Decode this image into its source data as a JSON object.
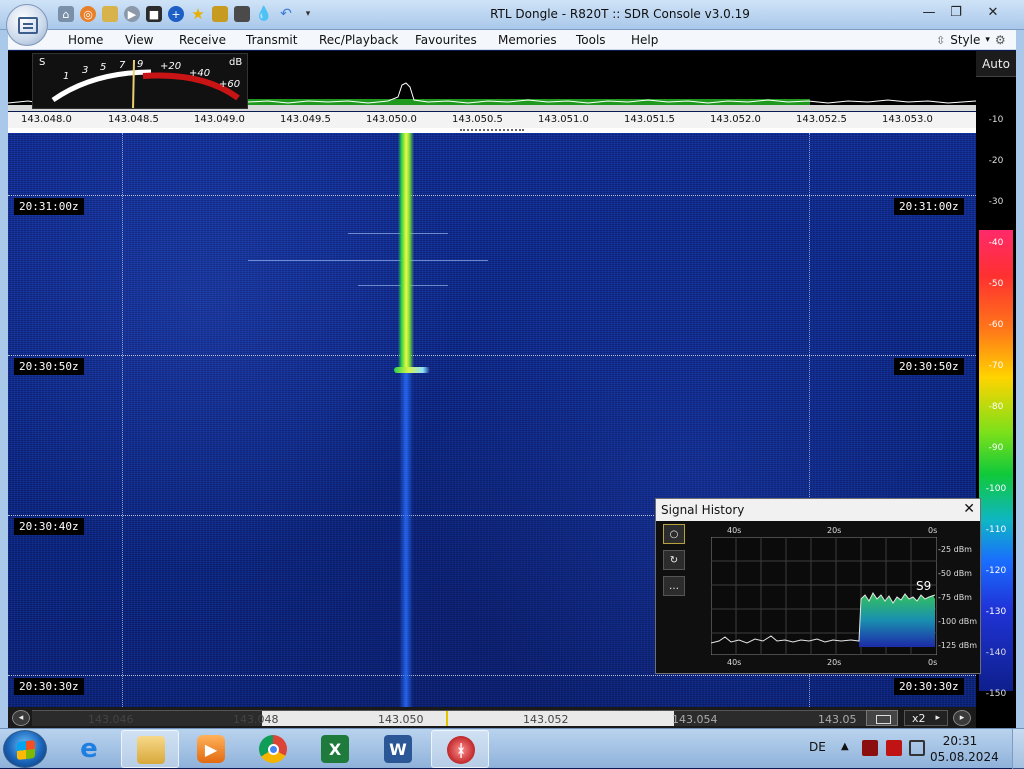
{
  "window": {
    "title": "RTL Dongle - R820T :: SDR Console v3.0.19",
    "minimize": "—",
    "maximize": "❐",
    "close": "✕"
  },
  "menu": {
    "items": [
      "Home",
      "View",
      "Receive",
      "Transmit",
      "Rec/Playback",
      "Favourites",
      "Memories",
      "Tools",
      "Help"
    ],
    "style_label": "Style"
  },
  "smeter": {
    "s_label": "S",
    "s_scale": [
      "1",
      "3",
      "5",
      "7",
      "9"
    ],
    "db_label": "dB",
    "db_scale": [
      "+20",
      "+40",
      "+60"
    ]
  },
  "frequency_axis": [
    "143.048.0",
    "143.048.5",
    "143.049.0",
    "143.049.5",
    "143.050.0",
    "143.050.5",
    "143.051.0",
    "143.051.5",
    "143.052.0",
    "143.052.5",
    "143.053.0"
  ],
  "waterfall": {
    "time_labels": [
      "20:31:00z",
      "20:30:50z",
      "20:30:40z",
      "20:30:30z"
    ]
  },
  "level_scale": {
    "auto_label": "Auto",
    "db_values": [
      "-10",
      "-20",
      "-30",
      "-40",
      "-50",
      "-60",
      "-70",
      "-80",
      "-90",
      "-100",
      "-110",
      "-120",
      "-130",
      "-140",
      "-150"
    ]
  },
  "bottom_bar": {
    "freq_labels": [
      "143.046",
      "143.048",
      "143.050",
      "143.052",
      "143.054",
      "143.05"
    ],
    "zoom_label": "x2",
    "zoom_arrow": "▸"
  },
  "signal_history": {
    "title": "Signal History",
    "close": "✕",
    "top_ticks": [
      "40s",
      "20s",
      "0s"
    ],
    "bottom_ticks": [
      "40s",
      "20s",
      "0s"
    ],
    "dbm_ticks": [
      "-25 dBm",
      "-50 dBm",
      "-75 dBm",
      "-100 dBm",
      "-125 dBm"
    ],
    "s_reading": "S9",
    "buttons": [
      "○",
      "↻",
      "…"
    ]
  },
  "taskbar": {
    "apps": [
      "internet-explorer",
      "file-explorer",
      "media-player",
      "chrome",
      "excel",
      "word",
      "sdr-console"
    ],
    "language": "DE",
    "tray_arrow": "▲",
    "time": "20:31",
    "date": "05.08.2024"
  },
  "colors": {
    "waterfall_bg": "#0d2a8c",
    "signal": "#d6f548",
    "meter_red": "#c81414"
  }
}
